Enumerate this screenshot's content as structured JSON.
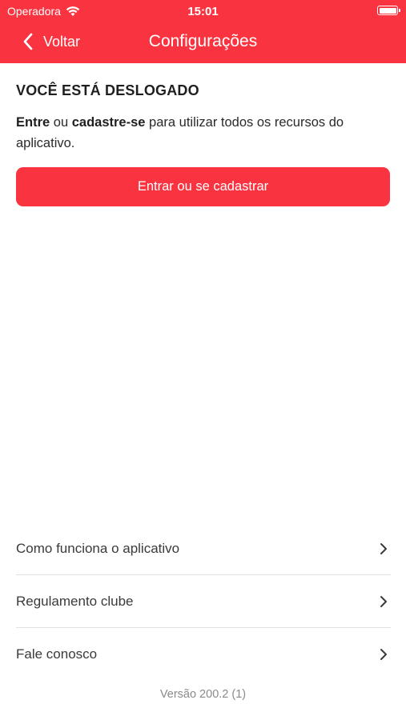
{
  "status_bar": {
    "carrier": "Operadora",
    "time": "15:01",
    "wifi_icon": "wifi-icon",
    "battery_icon": "battery-icon"
  },
  "nav": {
    "back_label": "Voltar",
    "back_icon": "chevron-left-icon",
    "title": "Configurações"
  },
  "logged_out": {
    "title": "VOCÊ ESTÁ DESLOGADO",
    "desc_bold_1": "Entre",
    "desc_text_1": " ou ",
    "desc_bold_2": "cadastre-se",
    "desc_text_2": " para utilizar todos os recursos do aplicativo."
  },
  "login_button": {
    "label": "Entrar ou se cadastrar"
  },
  "menu": {
    "items": [
      {
        "label": "Como funciona o aplicativo",
        "icon": "chevron-right-icon"
      },
      {
        "label": "Regulamento clube",
        "icon": "chevron-right-icon"
      },
      {
        "label": "Fale conosco",
        "icon": "chevron-right-icon"
      }
    ]
  },
  "version": "Versão 200.2 (1)",
  "colors": {
    "accent": "#f9333f",
    "text_primary": "#1f1f1f",
    "text_muted": "#8a8a8a",
    "divider": "#e2e2e2"
  }
}
